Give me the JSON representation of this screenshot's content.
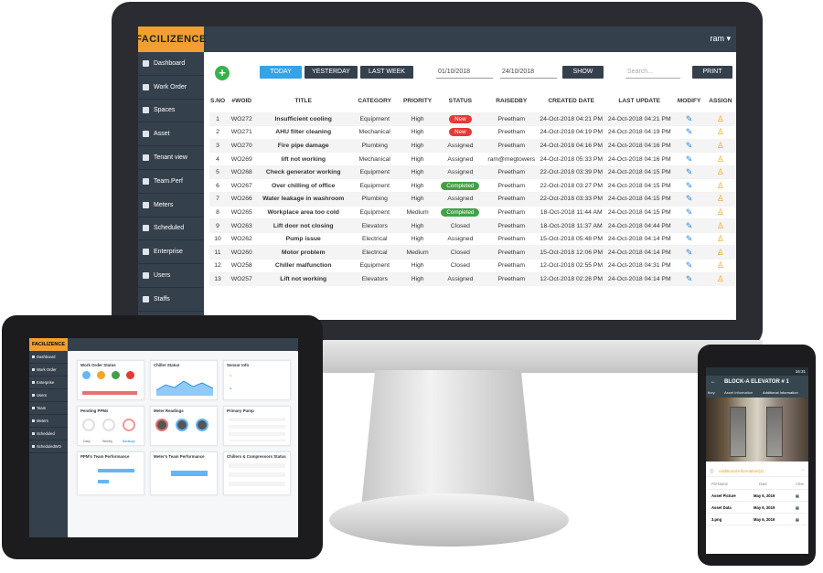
{
  "desktop": {
    "logo": "FACILIZENCE",
    "user": "ram",
    "sidebar": [
      "Dashboard",
      "Work Order",
      "Spaces",
      "Asset",
      "Tenant view",
      "Team.Perf",
      "Meters",
      "Scheduled",
      "Enterprise",
      "Users",
      "Staffs"
    ],
    "filters": {
      "today": "TODAY",
      "yesterday": "YESTERDAY",
      "last_week": "LAST WEEK",
      "date_from": "01/10/2018",
      "date_to": "24/10/2018",
      "show": "SHOW",
      "search_placeholder": "Search...",
      "print": "PRINT"
    },
    "columns": [
      "S.NO",
      "#WOID",
      "TITLE",
      "CATEGORY",
      "PRIORITY",
      "STATUS",
      "RAISEDBY",
      "CREATED DATE",
      "LAST UPDATE",
      "MODIFY",
      "ASSIGN"
    ],
    "rows": [
      {
        "sno": "1",
        "woid": "WO272",
        "title": "Insufficient cooling",
        "category": "Equipment",
        "priority": "High",
        "status": "New",
        "raisedby": "Preetham",
        "created": "24-Oct-2018 04:21 PM",
        "updated": "24-Oct-2018 04:21 PM"
      },
      {
        "sno": "2",
        "woid": "WO271",
        "title": "AHU filter cleaning",
        "category": "Mechanical",
        "priority": "High",
        "status": "New",
        "raisedby": "Preetham",
        "created": "24-Oct-2018 04:19 PM",
        "updated": "24-Oct-2018 04:19 PM"
      },
      {
        "sno": "3",
        "woid": "WO270",
        "title": "Fire pipe damage",
        "category": "Plumbing",
        "priority": "High",
        "status": "Assigned",
        "raisedby": "Preetham",
        "created": "24-Oct-2018 04:16 PM",
        "updated": "24-Oct-2018 04:16 PM"
      },
      {
        "sno": "4",
        "woid": "WO269",
        "title": "lift not working",
        "category": "Mechanical",
        "priority": "High",
        "status": "Assigned",
        "raisedby": "ram@megtowers",
        "created": "24-Oct-2018 05:33 PM",
        "updated": "24-Oct-2018 04:16 PM"
      },
      {
        "sno": "5",
        "woid": "WO268",
        "title": "Check generator working",
        "category": "Equipment",
        "priority": "High",
        "status": "Assigned",
        "raisedby": "Preetham",
        "created": "22-Oct-2018 03:39 PM",
        "updated": "24-Oct-2018 04:15 PM"
      },
      {
        "sno": "6",
        "woid": "WO267",
        "title": "Over chilling of office",
        "category": "Equipment",
        "priority": "High",
        "status": "Completed",
        "raisedby": "Preetham",
        "created": "22-Oct-2018 03:27 PM",
        "updated": "24-Oct-2018 04:15 PM"
      },
      {
        "sno": "7",
        "woid": "WO266",
        "title": "Water leakage in washroom",
        "category": "Plumbing",
        "priority": "High",
        "status": "Assigned",
        "raisedby": "Preetham",
        "created": "22-Oct-2018 03:33 PM",
        "updated": "24-Oct-2018 04:15 PM"
      },
      {
        "sno": "8",
        "woid": "WO265",
        "title": "Workplace area too cold",
        "category": "Equipment",
        "priority": "Medium",
        "status": "Completed",
        "raisedby": "Preetham",
        "created": "18-Oct-2018 11:44 AM",
        "updated": "24-Oct-2018 04:15 PM"
      },
      {
        "sno": "9",
        "woid": "WO263",
        "title": "Lift door not closing",
        "category": "Elevators",
        "priority": "High",
        "status": "Closed",
        "raisedby": "Preetham",
        "created": "18-Oct-2018 11:37 AM",
        "updated": "24-Oct-2018 04:44 PM"
      },
      {
        "sno": "10",
        "woid": "WO262",
        "title": "Pump issue",
        "category": "Electrical",
        "priority": "High",
        "status": "Assigned",
        "raisedby": "Preetham",
        "created": "15-Oct-2018 05:48 PM",
        "updated": "24-Oct-2018 04:14 PM"
      },
      {
        "sno": "11",
        "woid": "WO260",
        "title": "Motor problem",
        "category": "Electrical",
        "priority": "Medium",
        "status": "Closed",
        "raisedby": "Preetham",
        "created": "15-Oct-2018 12:06 PM",
        "updated": "24-Oct-2018 04:14 PM"
      },
      {
        "sno": "12",
        "woid": "WO258",
        "title": "Chiller malfunction",
        "category": "Equipment",
        "priority": "High",
        "status": "Closed",
        "raisedby": "Preetham",
        "created": "12-Oct-2018 02:55 PM",
        "updated": "24-Oct-2018 04:31 PM"
      },
      {
        "sno": "13",
        "woid": "WO257",
        "title": "Lift not working",
        "category": "Elevators",
        "priority": "High",
        "status": "Assigned",
        "raisedby": "Preetham",
        "created": "12-Oct-2018 02:26 PM",
        "updated": "24-Oct-2018 04:14 PM"
      }
    ]
  },
  "tablet": {
    "logo": "FACILIZENCE",
    "sidebar": [
      "Dashboard",
      "Work Order",
      "Enterprise",
      "Users",
      "Team",
      "Meters",
      "Scheduled",
      "ScheduledWO"
    ],
    "cards": {
      "work_order_status": "Work Order Status",
      "chiller_status": "Chiller Status",
      "sensor_info": "Sensor Info",
      "pending_ppms": "Pending PPMs",
      "meter_readings": "Meter Readings",
      "primary_pump": "Primary Pump",
      "ppms_team_perf": "PPM's Team Performance",
      "meters_team_perf": "Meter's Team Performance",
      "chillers_status": "Chillers & Compressors Status"
    },
    "labels": {
      "daily": "Daily",
      "weekly": "Weekly",
      "backlogs": "Backlogs"
    }
  },
  "phone": {
    "time": "16:31",
    "title": "BLOCK-A ELEVATOR # 1",
    "tabs": [
      "ttory",
      "Asset Information",
      "Additional Information"
    ],
    "section": "Additional Information(3)",
    "columns": [
      "FileName",
      "Date",
      "View"
    ],
    "files": [
      {
        "name": "Asset Picture",
        "date": "May 6, 2019"
      },
      {
        "name": "Asset Data",
        "date": "May 6, 2019"
      },
      {
        "name": "3.png",
        "date": "May 6, 2019"
      }
    ]
  }
}
